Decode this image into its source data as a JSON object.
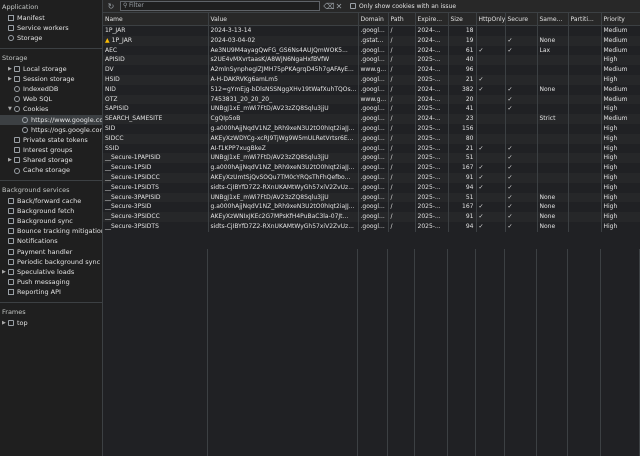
{
  "sidebar": {
    "application": {
      "title": "Application",
      "items": [
        "Manifest",
        "Service workers",
        "Storage"
      ]
    },
    "storage": {
      "title": "Storage",
      "items": [
        "Local storage",
        "Session storage",
        "IndexedDB",
        "Web SQL",
        "Cookies"
      ],
      "cookies_children": [
        "https://www.google.com",
        "https://ogs.google.com"
      ],
      "more": [
        "Private state tokens",
        "Interest groups",
        "Shared storage",
        "Cache storage"
      ]
    },
    "background": {
      "title": "Background services",
      "items": [
        "Back/forward cache",
        "Background fetch",
        "Background sync",
        "Bounce tracking mitigations",
        "Notifications",
        "Payment handler",
        "Periodic background sync",
        "Speculative loads",
        "Push messaging",
        "Reporting API"
      ]
    },
    "frames": {
      "title": "Frames",
      "items": [
        "top"
      ]
    }
  },
  "toolbar": {
    "filter_placeholder": "Filter",
    "only_issue_label": "Only show cookies with an issue"
  },
  "table": {
    "columns": [
      "Name",
      "Value",
      "Domain",
      "Path",
      "Expire...",
      "Size",
      "HttpOnly",
      "Secure",
      "Same...",
      "Partiti...",
      "Priority"
    ],
    "rows": [
      {
        "name": "1P_JAR",
        "value": "2024-3-13-14",
        "domain": ".googl...",
        "path": "/",
        "expires": "2024-...",
        "size": "18",
        "httponly": "",
        "secure": "",
        "samesite": "",
        "partition": "",
        "priority": "Medium",
        "warn": false
      },
      {
        "name": "1P_JAR",
        "value": "2024-03-04-02",
        "domain": ".gstat...",
        "path": "/",
        "expires": "2024-...",
        "size": "19",
        "httponly": "",
        "secure": "✓",
        "samesite": "None",
        "partition": "",
        "priority": "Medium",
        "warn": true
      },
      {
        "name": "AEC",
        "value": "Ae3NU9M4ayagQwFG_GS6Ns4AUJQmWOK5...",
        "domain": ".googl...",
        "path": "/",
        "expires": "2024-...",
        "size": "61",
        "httponly": "✓",
        "secure": "✓",
        "samesite": "Lax",
        "partition": "",
        "priority": "Medium",
        "warn": false
      },
      {
        "name": "APISID",
        "value": "s2UE4vMXvrtaasK/A8WjN6NgaHxfBVfW",
        "domain": ".googl...",
        "path": "/",
        "expires": "2025-...",
        "size": "40",
        "httponly": "",
        "secure": "",
        "samesite": "",
        "partition": "",
        "priority": "High",
        "warn": false
      },
      {
        "name": "DV",
        "value": "A2mlnSynphegIZJMH75pPKAgrqD45h7gAFAyE...",
        "domain": "www.g...",
        "path": "/",
        "expires": "2024-...",
        "size": "96",
        "httponly": "",
        "secure": "",
        "samesite": "",
        "partition": "",
        "priority": "Medium",
        "warn": false
      },
      {
        "name": "HSID",
        "value": "A-H-DAKRVKg6amLm5",
        "domain": ".googl...",
        "path": "/",
        "expires": "2025-...",
        "size": "21",
        "httponly": "✓",
        "secure": "",
        "samesite": "",
        "partition": "",
        "priority": "High",
        "warn": false
      },
      {
        "name": "NID",
        "value": "512=gYmEjg-bDlsNSSNggXHv19tWafXuhTQOs...",
        "domain": ".googl...",
        "path": "/",
        "expires": "2024-...",
        "size": "382",
        "httponly": "✓",
        "secure": "✓",
        "samesite": "None",
        "partition": "",
        "priority": "Medium",
        "warn": false
      },
      {
        "name": "OTZ",
        "value": "7453831_20_20_20_",
        "domain": "www.g...",
        "path": "/",
        "expires": "2024-...",
        "size": "20",
        "httponly": "",
        "secure": "✓",
        "samesite": "",
        "partition": "",
        "priority": "Medium",
        "warn": false
      },
      {
        "name": "SAPISID",
        "value": "UNBgJ1xE_mWi7FtD/AV23zZQ8Sqlu3jjU",
        "domain": ".googl...",
        "path": "/",
        "expires": "2025-...",
        "size": "41",
        "httponly": "",
        "secure": "✓",
        "samesite": "",
        "partition": "",
        "priority": "High",
        "warn": false
      },
      {
        "name": "SEARCH_SAMESITE",
        "value": "CgQIp5oB",
        "domain": ".googl...",
        "path": "/",
        "expires": "2024-...",
        "size": "23",
        "httponly": "",
        "secure": "",
        "samesite": "Strict",
        "partition": "",
        "priority": "Medium",
        "warn": false
      },
      {
        "name": "SID",
        "value": "g.a000hAjjNqdV1NZ_bRh9xeN3U2tO0hIqt2iaJJ...",
        "domain": ".googl...",
        "path": "/",
        "expires": "2025-...",
        "size": "156",
        "httponly": "",
        "secure": "",
        "samesite": "",
        "partition": "",
        "priority": "High",
        "warn": false
      },
      {
        "name": "SIDCC",
        "value": "AKEyXzWDYCg-xcRJ9TjWg9W5mULRetVrtsr6E...",
        "domain": ".googl...",
        "path": "/",
        "expires": "2025-...",
        "size": "80",
        "httponly": "",
        "secure": "",
        "samesite": "",
        "partition": "",
        "priority": "High",
        "warn": false
      },
      {
        "name": "SSID",
        "value": "AI-f1KPP7xugBkeZ",
        "domain": ".googl...",
        "path": "/",
        "expires": "2025-...",
        "size": "21",
        "httponly": "✓",
        "secure": "✓",
        "samesite": "",
        "partition": "",
        "priority": "High",
        "warn": false
      },
      {
        "name": "__Secure-1PAPISID",
        "value": "UNBgJ1xE_mWi7FtD/AV23zZQ8Sqlu3jjU",
        "domain": ".googl...",
        "path": "/",
        "expires": "2025-...",
        "size": "51",
        "httponly": "",
        "secure": "✓",
        "samesite": "",
        "partition": "",
        "priority": "High",
        "warn": false
      },
      {
        "name": "__Secure-1PSID",
        "value": "g.a000hAjjNqdV1NZ_bRh9xeN3U2tO0hIqt2iaJJ...",
        "domain": ".googl...",
        "path": "/",
        "expires": "2025-...",
        "size": "167",
        "httponly": "✓",
        "secure": "✓",
        "samesite": "",
        "partition": "",
        "priority": "High",
        "warn": false
      },
      {
        "name": "__Secure-1PSIDCC",
        "value": "AKEyXzUmtSjQvSOQu7TM0cYRQsThFhQefbo...",
        "domain": ".googl...",
        "path": "/",
        "expires": "2025-...",
        "size": "91",
        "httponly": "✓",
        "secure": "✓",
        "samesite": "",
        "partition": "",
        "priority": "High",
        "warn": false
      },
      {
        "name": "__Secure-1PSIDTS",
        "value": "sidts-CjIBYfD7Z2-RXnUKAMtWyGh57xiV2ZvUz...",
        "domain": ".googl...",
        "path": "/",
        "expires": "2025-...",
        "size": "94",
        "httponly": "✓",
        "secure": "✓",
        "samesite": "",
        "partition": "",
        "priority": "High",
        "warn": false
      },
      {
        "name": "__Secure-3PAPISID",
        "value": "UNBgJ1xE_mWi7FtD/AV23zZQ8Sqlu3jjU",
        "domain": ".googl...",
        "path": "/",
        "expires": "2025-...",
        "size": "51",
        "httponly": "",
        "secure": "✓",
        "samesite": "None",
        "partition": "",
        "priority": "High",
        "warn": false
      },
      {
        "name": "__Secure-3PSID",
        "value": "g.a000hAjjNqdV1NZ_bRh9xeN3U2tO0hIqt2iaJJ...",
        "domain": ".googl...",
        "path": "/",
        "expires": "2025-...",
        "size": "167",
        "httponly": "✓",
        "secure": "✓",
        "samesite": "None",
        "partition": "",
        "priority": "High",
        "warn": false
      },
      {
        "name": "__Secure-3PSIDCC",
        "value": "AKEyXzWNIxJKEc2G7MPsKfH4PuBaC3la-07Jt...",
        "domain": ".googl...",
        "path": "/",
        "expires": "2025-...",
        "size": "91",
        "httponly": "✓",
        "secure": "✓",
        "samesite": "None",
        "partition": "",
        "priority": "High",
        "warn": false
      },
      {
        "name": "__Secure-3PSIDTS",
        "value": "sidts-CjIBYfD7Z2-RXnUKAMtWyGh57xiV2ZvUz...",
        "domain": ".googl...",
        "path": "/",
        "expires": "2025-...",
        "size": "94",
        "httponly": "✓",
        "secure": "✓",
        "samesite": "None",
        "partition": "",
        "priority": "High",
        "warn": false
      }
    ]
  }
}
